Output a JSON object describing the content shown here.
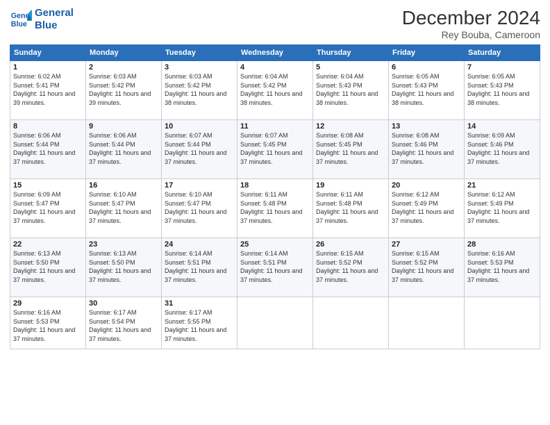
{
  "header": {
    "logo_line1": "General",
    "logo_line2": "Blue",
    "month": "December 2024",
    "location": "Rey Bouba, Cameroon"
  },
  "weekdays": [
    "Sunday",
    "Monday",
    "Tuesday",
    "Wednesday",
    "Thursday",
    "Friday",
    "Saturday"
  ],
  "weeks": [
    [
      {
        "day": "1",
        "sunrise": "6:02 AM",
        "sunset": "5:41 PM",
        "daylight": "11 hours and 39 minutes."
      },
      {
        "day": "2",
        "sunrise": "6:03 AM",
        "sunset": "5:42 PM",
        "daylight": "11 hours and 39 minutes."
      },
      {
        "day": "3",
        "sunrise": "6:03 AM",
        "sunset": "5:42 PM",
        "daylight": "11 hours and 38 minutes."
      },
      {
        "day": "4",
        "sunrise": "6:04 AM",
        "sunset": "5:42 PM",
        "daylight": "11 hours and 38 minutes."
      },
      {
        "day": "5",
        "sunrise": "6:04 AM",
        "sunset": "5:43 PM",
        "daylight": "11 hours and 38 minutes."
      },
      {
        "day": "6",
        "sunrise": "6:05 AM",
        "sunset": "5:43 PM",
        "daylight": "11 hours and 38 minutes."
      },
      {
        "day": "7",
        "sunrise": "6:05 AM",
        "sunset": "5:43 PM",
        "daylight": "11 hours and 38 minutes."
      }
    ],
    [
      {
        "day": "8",
        "sunrise": "6:06 AM",
        "sunset": "5:44 PM",
        "daylight": "11 hours and 37 minutes."
      },
      {
        "day": "9",
        "sunrise": "6:06 AM",
        "sunset": "5:44 PM",
        "daylight": "11 hours and 37 minutes."
      },
      {
        "day": "10",
        "sunrise": "6:07 AM",
        "sunset": "5:44 PM",
        "daylight": "11 hours and 37 minutes."
      },
      {
        "day": "11",
        "sunrise": "6:07 AM",
        "sunset": "5:45 PM",
        "daylight": "11 hours and 37 minutes."
      },
      {
        "day": "12",
        "sunrise": "6:08 AM",
        "sunset": "5:45 PM",
        "daylight": "11 hours and 37 minutes."
      },
      {
        "day": "13",
        "sunrise": "6:08 AM",
        "sunset": "5:46 PM",
        "daylight": "11 hours and 37 minutes."
      },
      {
        "day": "14",
        "sunrise": "6:09 AM",
        "sunset": "5:46 PM",
        "daylight": "11 hours and 37 minutes."
      }
    ],
    [
      {
        "day": "15",
        "sunrise": "6:09 AM",
        "sunset": "5:47 PM",
        "daylight": "11 hours and 37 minutes."
      },
      {
        "day": "16",
        "sunrise": "6:10 AM",
        "sunset": "5:47 PM",
        "daylight": "11 hours and 37 minutes."
      },
      {
        "day": "17",
        "sunrise": "6:10 AM",
        "sunset": "5:47 PM",
        "daylight": "11 hours and 37 minutes."
      },
      {
        "day": "18",
        "sunrise": "6:11 AM",
        "sunset": "5:48 PM",
        "daylight": "11 hours and 37 minutes."
      },
      {
        "day": "19",
        "sunrise": "6:11 AM",
        "sunset": "5:48 PM",
        "daylight": "11 hours and 37 minutes."
      },
      {
        "day": "20",
        "sunrise": "6:12 AM",
        "sunset": "5:49 PM",
        "daylight": "11 hours and 37 minutes."
      },
      {
        "day": "21",
        "sunrise": "6:12 AM",
        "sunset": "5:49 PM",
        "daylight": "11 hours and 37 minutes."
      }
    ],
    [
      {
        "day": "22",
        "sunrise": "6:13 AM",
        "sunset": "5:50 PM",
        "daylight": "11 hours and 37 minutes."
      },
      {
        "day": "23",
        "sunrise": "6:13 AM",
        "sunset": "5:50 PM",
        "daylight": "11 hours and 37 minutes."
      },
      {
        "day": "24",
        "sunrise": "6:14 AM",
        "sunset": "5:51 PM",
        "daylight": "11 hours and 37 minutes."
      },
      {
        "day": "25",
        "sunrise": "6:14 AM",
        "sunset": "5:51 PM",
        "daylight": "11 hours and 37 minutes."
      },
      {
        "day": "26",
        "sunrise": "6:15 AM",
        "sunset": "5:52 PM",
        "daylight": "11 hours and 37 minutes."
      },
      {
        "day": "27",
        "sunrise": "6:15 AM",
        "sunset": "5:52 PM",
        "daylight": "11 hours and 37 minutes."
      },
      {
        "day": "28",
        "sunrise": "6:16 AM",
        "sunset": "5:53 PM",
        "daylight": "11 hours and 37 minutes."
      }
    ],
    [
      {
        "day": "29",
        "sunrise": "6:16 AM",
        "sunset": "5:53 PM",
        "daylight": "11 hours and 37 minutes."
      },
      {
        "day": "30",
        "sunrise": "6:17 AM",
        "sunset": "5:54 PM",
        "daylight": "11 hours and 37 minutes."
      },
      {
        "day": "31",
        "sunrise": "6:17 AM",
        "sunset": "5:55 PM",
        "daylight": "11 hours and 37 minutes."
      },
      null,
      null,
      null,
      null
    ]
  ]
}
